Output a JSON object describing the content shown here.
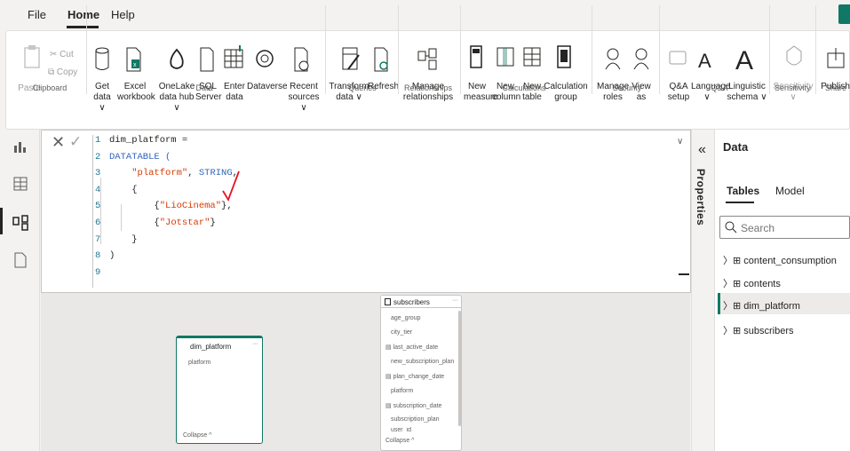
{
  "menu": {
    "file": "File",
    "home": "Home",
    "help": "Help"
  },
  "ribbon": {
    "paste": "Paste",
    "cut": "Cut",
    "copy": "Copy",
    "get_data": "Get\ndata ∨",
    "excel": "Excel\nworkbook",
    "onelake": "OneLake\ndata hub ∨",
    "sql": "SQL\nServer",
    "enter_data": "Enter\ndata",
    "dataverse": "Dataverse",
    "recent": "Recent\nsources ∨",
    "transform": "Transform\ndata ∨",
    "refresh": "Refresh",
    "manage_rel": "Manage\nrelationships",
    "new_measure": "New\nmeasure",
    "new_column": "New\ncolumn",
    "new_table": "New\ntable",
    "calc_group": "Calculation\ngroup",
    "manage_roles": "Manage\nroles",
    "view_as": "View\nas",
    "qa_setup": "Q&A\nsetup",
    "language": "Language\n∨",
    "linguistic": "Linguistic\nschema ∨",
    "sensitivity": "Sensitivity\n∨",
    "publish": "Publish",
    "groups": {
      "clipboard": "Clipboard",
      "data": "Data",
      "queries": "Queries",
      "relationships": "Relationships",
      "calculations": "Calculations",
      "security": "Security",
      "qa": "Q&A",
      "sensitivity": "Sensitivity",
      "share": "Share"
    }
  },
  "formula": {
    "lines": [
      {
        "n": "1",
        "parts": [
          [
            "",
            "dim_platform ="
          ]
        ]
      },
      {
        "n": "2",
        "parts": [
          [
            "kw",
            "DATATABLE ("
          ]
        ]
      },
      {
        "n": "3",
        "parts": [
          [
            "",
            "    "
          ],
          [
            "str",
            "\"platform\""
          ],
          [
            "",
            ", "
          ],
          [
            "kw",
            "STRING"
          ],
          [
            "",
            ","
          ]
        ]
      },
      {
        "n": "4",
        "parts": [
          [
            "",
            "    {"
          ]
        ]
      },
      {
        "n": "5",
        "parts": [
          [
            "",
            "        {"
          ],
          [
            "str",
            "\"LioCinema\""
          ],
          [
            "",
            "},"
          ]
        ]
      },
      {
        "n": "6",
        "parts": [
          [
            "",
            "        {"
          ],
          [
            "str",
            "\"Jotstar\""
          ],
          [
            "",
            "}"
          ]
        ]
      },
      {
        "n": "7",
        "parts": [
          [
            "",
            "    }"
          ]
        ]
      },
      {
        "n": "8",
        "parts": [
          [
            "",
            ")"
          ]
        ]
      },
      {
        "n": "9",
        "parts": [
          [
            "",
            ""
          ]
        ]
      }
    ]
  },
  "cards": {
    "dim": {
      "title": "dim_platform",
      "field": "platform",
      "collapse": "Collapse ^",
      "more": "···"
    },
    "subs": {
      "title": "subscribers",
      "more": "···",
      "collapse": "Collapse ^",
      "fields": [
        "age_group",
        "city_tier",
        "last_active_date",
        "new_subscription_plan",
        "plan_change_date",
        "platform",
        "subscription_date",
        "subscription_plan",
        "user_id"
      ]
    }
  },
  "properties": {
    "label": "Properties"
  },
  "datapane": {
    "title": "Data",
    "tab_tables": "Tables",
    "tab_model": "Model",
    "search_placeholder": "Search",
    "tables": [
      "content_consumption",
      "contents",
      "dim_platform",
      "subscribers"
    ]
  }
}
